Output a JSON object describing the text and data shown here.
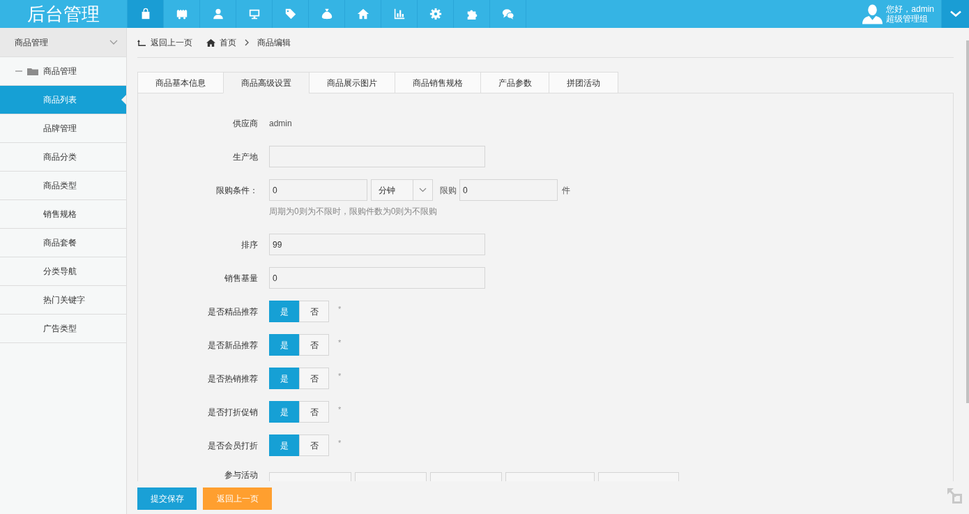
{
  "header": {
    "title": "后台管理",
    "nav": [
      {
        "kind": "bag",
        "selected": true
      },
      {
        "kind": "shop",
        "selected": false
      },
      {
        "kind": "user",
        "selected": false
      },
      {
        "kind": "monitor",
        "selected": false
      },
      {
        "kind": "tag",
        "selected": false
      },
      {
        "kind": "money",
        "selected": false
      },
      {
        "kind": "home",
        "selected": false
      },
      {
        "kind": "chart",
        "selected": false
      },
      {
        "kind": "gear",
        "selected": false
      },
      {
        "kind": "puzzle",
        "selected": false
      },
      {
        "kind": "chat",
        "selected": false
      }
    ],
    "user": {
      "greeting": "您好，admin",
      "role": "超级管理组"
    }
  },
  "sidebar": {
    "header": "商品管理",
    "tree": [
      {
        "label": "商品管理",
        "expanded": true,
        "children": [
          {
            "label": "商品列表",
            "selected": true
          },
          {
            "label": "品牌管理",
            "selected": false
          },
          {
            "label": "商品分类",
            "selected": false
          },
          {
            "label": "商品类型",
            "selected": false
          },
          {
            "label": "销售规格",
            "selected": false
          },
          {
            "label": "商品套餐",
            "selected": false
          },
          {
            "label": "分类导航",
            "selected": false
          },
          {
            "label": "热门关键字",
            "selected": false
          },
          {
            "label": "广告类型",
            "selected": false
          }
        ]
      }
    ]
  },
  "breadcrumb": {
    "back": "返回上一页",
    "items": [
      {
        "kind": "home",
        "label": "首页"
      },
      {
        "kind": "current",
        "label": "商品编辑"
      }
    ]
  },
  "tabs": [
    {
      "label": "商品基本信息",
      "selected": false
    },
    {
      "label": "商品高级设置",
      "selected": true
    },
    {
      "label": "商品展示图片",
      "selected": false
    },
    {
      "label": "商品销售规格",
      "selected": false
    },
    {
      "label": "产品参数",
      "selected": false
    },
    {
      "label": "拼团活动",
      "selected": false
    }
  ],
  "form": {
    "fields": [
      {
        "kind": "text",
        "label": "供应商",
        "value": "admin"
      },
      {
        "kind": "input",
        "label": "生产地"
      },
      {
        "kind": "limit",
        "label": "限购条件：",
        "period": "0",
        "unit": "分钟",
        "count_label": "限购",
        "count": "0",
        "count_unit": "件",
        "hint": "周期为0则为不限时，限购件数为0则为不限购"
      },
      {
        "kind": "input",
        "label": "排序",
        "value": "99"
      },
      {
        "kind": "input",
        "label": "销售基量",
        "value": "0"
      },
      {
        "kind": "toggle",
        "label": "是否精品推荐",
        "options": [
          {
            "label": "是",
            "selected": true
          },
          {
            "label": "否",
            "selected": false
          }
        ],
        "mark": "*"
      },
      {
        "kind": "toggle",
        "label": "是否新品推荐",
        "options": [
          {
            "label": "是",
            "selected": true
          },
          {
            "label": "否",
            "selected": false
          }
        ],
        "mark": "*"
      },
      {
        "kind": "toggle",
        "label": "是否热销推荐",
        "options": [
          {
            "label": "是",
            "selected": true
          },
          {
            "label": "否",
            "selected": false
          }
        ],
        "mark": "*"
      },
      {
        "kind": "toggle",
        "label": "是否打折促销",
        "options": [
          {
            "label": "是",
            "selected": true
          },
          {
            "label": "否",
            "selected": false
          }
        ],
        "mark": "*"
      },
      {
        "kind": "toggle",
        "label": "是否会员打折",
        "options": [
          {
            "label": "是",
            "selected": true
          },
          {
            "label": "否",
            "selected": false
          }
        ],
        "mark": "*"
      },
      {
        "kind": "activities",
        "label": "参与活动"
      }
    ]
  },
  "footer": {
    "buttons": [
      {
        "kind": "primary",
        "label": "提交保存"
      },
      {
        "kind": "warning",
        "label": "返回上一页"
      }
    ]
  }
}
